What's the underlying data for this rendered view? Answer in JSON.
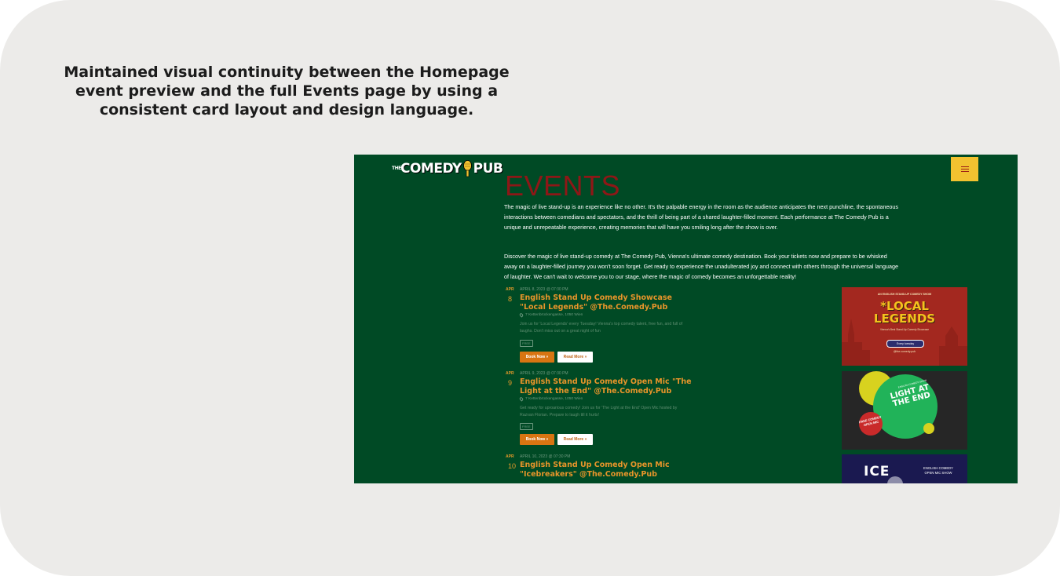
{
  "caption": "Maintained visual continuity between the Homepage event preview and the full Events page by using a consistent card layout and design language.",
  "site": {
    "logo_the": "THE",
    "logo_comedy": "COMEDY",
    "logo_pub": "PUB",
    "menu_icon": "hamburger-menu-icon"
  },
  "page": {
    "title": "EVENTS",
    "intro_1": "The magic of live stand-up is an experience like no other. It's the palpable energy in the room as the audience anticipates the next punchline, the spontaneous interactions between comedians and spectators, and the thrill of being part of a shared laughter-filled moment. Each performance at The Comedy Pub is a unique and unrepeatable experience, creating memories that will have you smiling long after the show is over.",
    "intro_2": "Discover the magic of live stand-up comedy at The Comedy Pub, Vienna's ultimate comedy destination. Book your tickets now and prepare to be whisked away on a laughter-filled journey you won't soon forget. Get ready to experience the unadulterated joy and connect with others through the universal language of laughter. We can't wait to welcome you to our stage, where the magic of comedy becomes an unforgettable reality!"
  },
  "events": [
    {
      "month": "APR",
      "day": "8",
      "datetime": "APRIL 8, 2023 @ 07:30 PM",
      "title": "English Stand Up Comedy Showcase \"Local Legends\" @The.Comedy.Pub",
      "location": "7 Kettenbrückengasse, 1050 Wien",
      "description": "Join us for 'Local Legends' every Tuesday! Vienna's top comedy talent, free fun, and full of laughs. Don't miss out on a great night of fun",
      "tag": "FREE",
      "book_label": "Book Now »",
      "read_label": "Read More »",
      "image": {
        "top": "AN ENGLISH STAND-UP COMEDY SHOW",
        "headline": "*LOCAL LEGENDS",
        "sub": "Vienna's Best Stand-Up Comedy Showcase",
        "pill": "Every tuesday",
        "handle": "@the.comedy.pub"
      }
    },
    {
      "month": "APR",
      "day": "9",
      "datetime": "APRIL 9, 2023 @ 07:30 PM",
      "title": "English Stand Up Comedy Open Mic \"The Light at the End\" @The.Comedy.Pub",
      "location": "7 Kettenbrückengasse, 1050 Wien",
      "description": "Get ready for uproarious comedy! Join us for 'The Light at the End' Open Mic hosted by Razvan Florian. Prepare to laugh till it hurts!",
      "tag": "FREE",
      "book_label": "Book Now »",
      "read_label": "Read More »",
      "image": {
        "small": "ENGLISH COMEDY SHOW",
        "headline": "LIGHT AT THE END",
        "free": "FREE COMEDY OPEN MIC"
      }
    },
    {
      "month": "APR",
      "day": "10",
      "datetime": "APRIL 10, 2023 @ 07:30 PM",
      "title": "English Stand Up Comedy Open Mic \"Icebreakers\" @The.Comedy.Pub",
      "image": {
        "headline": "ICE",
        "sub": "ENGLISH COMEDY OPEN MIC SHOW"
      }
    }
  ],
  "colors": {
    "page_bg": "#004a25",
    "title": "#8e1717",
    "accent": "#e8952a",
    "menu_button": "#f2c230"
  }
}
